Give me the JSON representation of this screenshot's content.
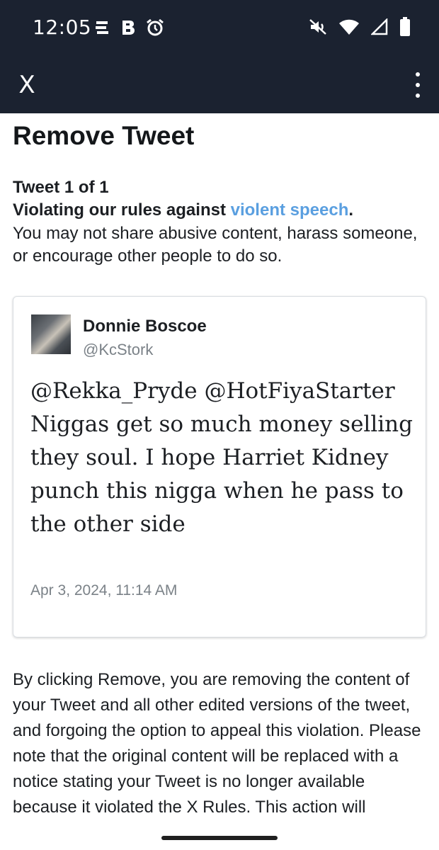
{
  "status_bar": {
    "time": "12:05",
    "left_icons": [
      "news-icon",
      "b-app-icon",
      "alarm-icon"
    ],
    "right_icons": [
      "mute-icon",
      "wifi-icon",
      "signal-icon",
      "battery-icon"
    ]
  },
  "app_bar": {
    "close_label": "X",
    "menu_icon": "more-vert-icon",
    "background": "#1b2230"
  },
  "page": {
    "title": "Remove Tweet",
    "tweet_count": "Tweet 1 of 1",
    "violation_prefix": "Violating our rules against ",
    "violation_link": "violent speech",
    "violation_suffix": ".",
    "violation_description": "You may not share abusive content, harass someone, or encourage other people to do so."
  },
  "tweet": {
    "author_name": "Donnie Boscoe",
    "author_handle": "@KcStork",
    "text": "@Rekka_Pryde @HotFiyaStarter Niggas get so much money selling they soul. I hope Harriet Kidney punch this nigga when he pass to the other side",
    "date": "Apr 3, 2024, 11:14 AM"
  },
  "notice": {
    "text": "By clicking Remove, you are removing the content of your Tweet and all other edited versions of the tweet, and forgoing the option to appeal this violation. Please note that the original content will be replaced with a notice stating your Tweet is no longer available because it violated the X Rules. This action will"
  },
  "colors": {
    "link": "#5a9fe0",
    "text": "#1c1f23",
    "muted": "#7b8288"
  }
}
